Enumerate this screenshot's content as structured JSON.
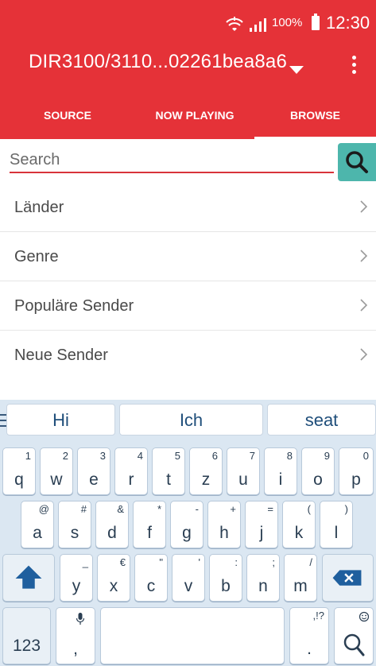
{
  "status_bar": {
    "battery": "100%",
    "time": "12:30"
  },
  "header": {
    "device_name": "DIR3100/3110...02261bea8a6"
  },
  "tabs": [
    {
      "label": "SOURCE"
    },
    {
      "label": "NOW PLAYING"
    },
    {
      "label": "BROWSE"
    }
  ],
  "search": {
    "placeholder": "Search",
    "value": ""
  },
  "browse_items": [
    {
      "label": "Länder"
    },
    {
      "label": "Genre"
    },
    {
      "label": "Populäre Sender"
    },
    {
      "label": "Neue Sender"
    }
  ],
  "keyboard": {
    "suggestions": [
      "Hi",
      "Ich",
      "seat"
    ],
    "row1": [
      {
        "main": "q",
        "sub": "1"
      },
      {
        "main": "w",
        "sub": "2"
      },
      {
        "main": "e",
        "sub": "3"
      },
      {
        "main": "r",
        "sub": "4"
      },
      {
        "main": "t",
        "sub": "5"
      },
      {
        "main": "z",
        "sub": "6"
      },
      {
        "main": "u",
        "sub": "7"
      },
      {
        "main": "i",
        "sub": "8"
      },
      {
        "main": "o",
        "sub": "9"
      },
      {
        "main": "p",
        "sub": "0"
      }
    ],
    "row2": [
      {
        "main": "a",
        "sub": "@"
      },
      {
        "main": "s",
        "sub": "#"
      },
      {
        "main": "d",
        "sub": "&"
      },
      {
        "main": "f",
        "sub": "*"
      },
      {
        "main": "g",
        "sub": "-"
      },
      {
        "main": "h",
        "sub": "+"
      },
      {
        "main": "j",
        "sub": "="
      },
      {
        "main": "k",
        "sub": "("
      },
      {
        "main": "l",
        "sub": ")"
      }
    ],
    "row3": [
      {
        "main": "y",
        "sub": "_"
      },
      {
        "main": "x",
        "sub": "€"
      },
      {
        "main": "c",
        "sub": "\""
      },
      {
        "main": "v",
        "sub": "'"
      },
      {
        "main": "b",
        "sub": ":"
      },
      {
        "main": "n",
        "sub": ";"
      },
      {
        "main": "m",
        "sub": "/"
      }
    ],
    "row4": {
      "numbers_label": "123",
      "comma_main": ",",
      "period_main": ".",
      "period_sub": ",!?"
    },
    "colors": {
      "key_text": "#2a3e52",
      "accent_blue": "#1f5f9e",
      "background": "#dbe7f2"
    }
  },
  "colors": {
    "app_red": "#e53238",
    "search_teal": "#4db6ac"
  }
}
